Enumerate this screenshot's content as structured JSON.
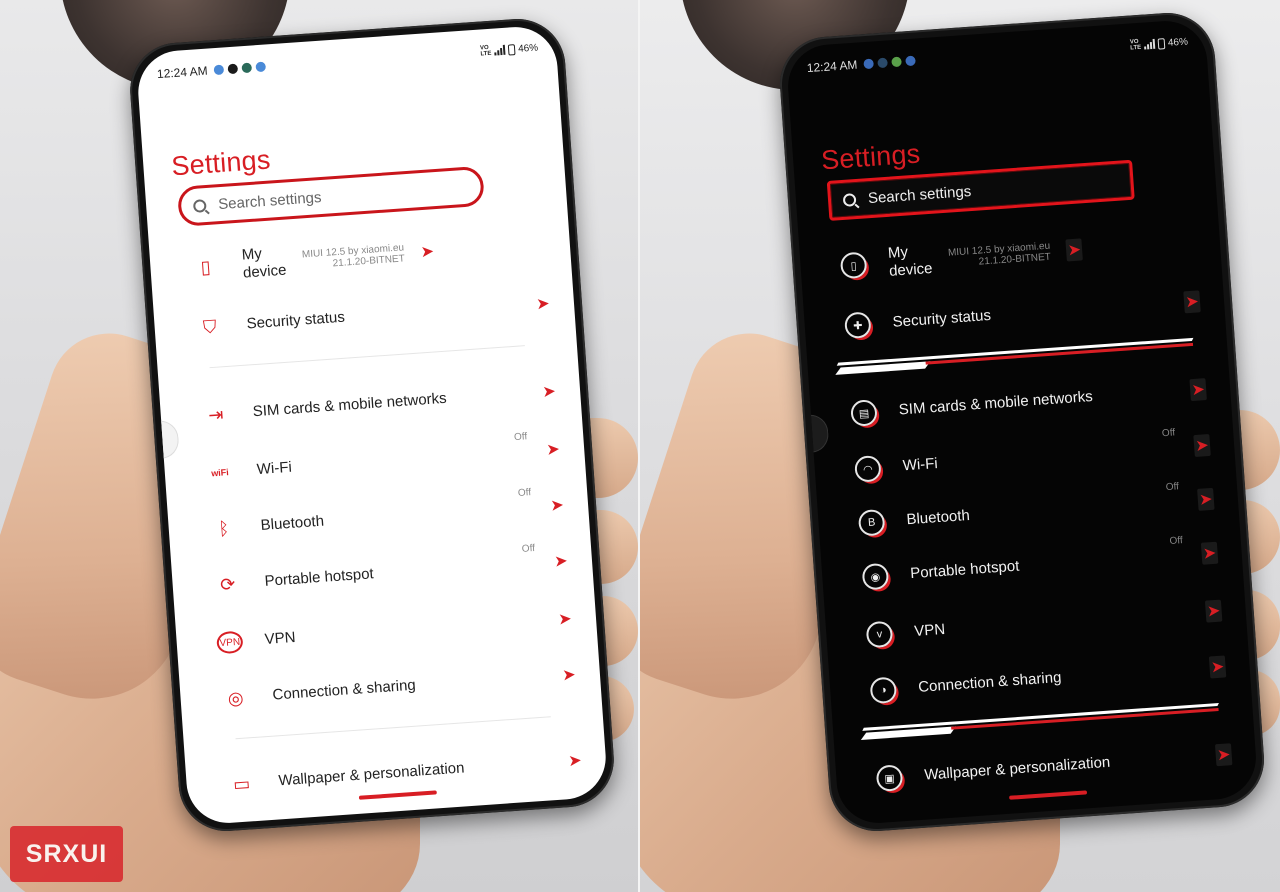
{
  "watermark": "SRXUI",
  "status": {
    "time": "12:24 AM",
    "volte_top": "VO",
    "volte_bottom": "LTE",
    "battery": "46%"
  },
  "colors": {
    "accent": "#d81e24",
    "light_bg": "#ffffff",
    "dark_bg": "#050505"
  },
  "light": {
    "title": "Settings",
    "search_placeholder": "Search settings",
    "items": [
      {
        "icon": "phone-check-icon",
        "glyph": "▯",
        "label": "My device",
        "meta_line1": "MIUI 12.5 by xiaomi.eu",
        "meta_line2": "21.1.20-BITNET"
      },
      {
        "icon": "shield-check-icon",
        "glyph": "⛉",
        "label": "Security status"
      },
      {
        "icon": "sim-card-icon",
        "glyph": "⇥",
        "label": "SIM cards & mobile networks"
      },
      {
        "icon": "wifi-icon",
        "glyph": "wiFi",
        "label": "Wi-Fi",
        "state": "Off"
      },
      {
        "icon": "bluetooth-icon",
        "glyph": "ᛒ",
        "label": "Bluetooth",
        "state": "Off"
      },
      {
        "icon": "hotspot-icon",
        "glyph": "⟳",
        "label": "Portable hotspot",
        "state": "Off"
      },
      {
        "icon": "vpn-icon",
        "glyph": "VPN",
        "label": "VPN"
      },
      {
        "icon": "connection-sharing-icon",
        "glyph": "◎",
        "label": "Connection & sharing"
      },
      {
        "icon": "wallpaper-icon",
        "glyph": "▭",
        "label": "Wallpaper & personalization"
      }
    ]
  },
  "dark": {
    "title": "Settings",
    "search_placeholder": "Search settings",
    "items": [
      {
        "icon": "phone-icon",
        "glyph": "▯",
        "label": "My device",
        "meta_line1": "MIUI 12.5 by xiaomi.eu",
        "meta_line2": "21.1.20-BITNET"
      },
      {
        "icon": "security-icon",
        "glyph": "✚",
        "label": "Security status"
      },
      {
        "icon": "sim-card-icon",
        "glyph": "▤",
        "label": "SIM cards & mobile networks"
      },
      {
        "icon": "wifi-icon",
        "glyph": "◠",
        "label": "Wi-Fi",
        "state": "Off"
      },
      {
        "icon": "bluetooth-icon",
        "glyph": "B",
        "label": "Bluetooth",
        "state": "Off"
      },
      {
        "icon": "hotspot-icon",
        "glyph": "◉",
        "label": "Portable hotspot",
        "state": "Off"
      },
      {
        "icon": "vpn-icon",
        "glyph": "v",
        "label": "VPN"
      },
      {
        "icon": "connection-sharing-icon",
        "glyph": "◑",
        "label": "Connection & sharing"
      },
      {
        "icon": "wallpaper-icon",
        "glyph": "▣",
        "label": "Wallpaper & personalization"
      }
    ]
  },
  "chevron": "➤"
}
